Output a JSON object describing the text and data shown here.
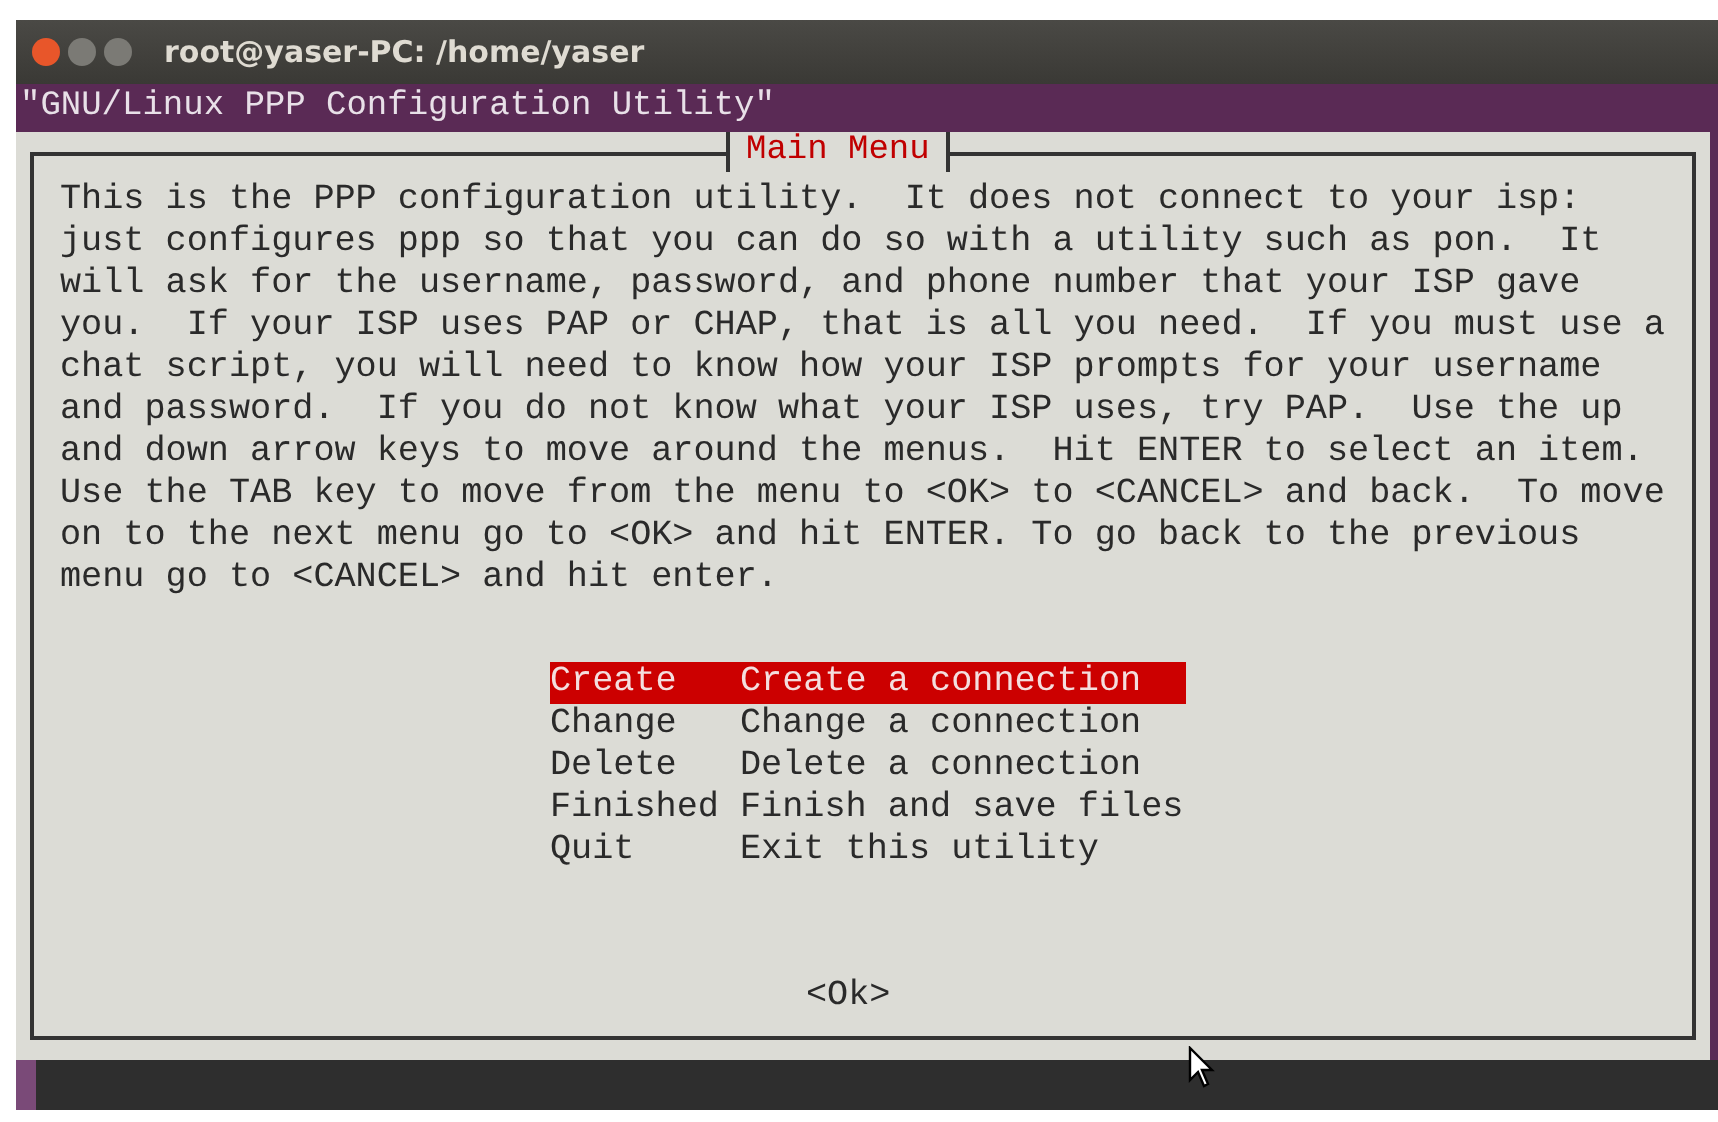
{
  "window": {
    "title": "root@yaser-PC: /home/yaser"
  },
  "backtitle": "\"GNU/Linux PPP Configuration Utility\"",
  "dialog": {
    "title": "Main Menu",
    "message": "This is the PPP configuration utility.  It does not connect to your isp:\njust configures ppp so that you can do so with a utility such as pon.  It\nwill ask for the username, password, and phone number that your ISP gave\nyou.  If your ISP uses PAP or CHAP, that is all you need.  If you must use a\nchat script, you will need to know how your ISP prompts for your username\nand password.  If you do not know what your ISP uses, try PAP.  Use the up\nand down arrow keys to move around the menus.  Hit ENTER to select an item.\nUse the TAB key to move from the menu to <OK> to <CANCEL> and back.  To move\non to the next menu go to <OK> and hit ENTER. To go back to the previous\nmenu go to <CANCEL> and hit enter.",
    "menu": [
      {
        "tag": "Create",
        "description": "Create a connection",
        "selected": true
      },
      {
        "tag": "Change",
        "description": "Change a connection",
        "selected": false
      },
      {
        "tag": "Delete",
        "description": "Delete a connection",
        "selected": false
      },
      {
        "tag": "Finished",
        "description": "Finish and save files",
        "selected": false
      },
      {
        "tag": "Quit",
        "description": "Exit this utility",
        "selected": false
      }
    ],
    "buttons": [
      "<Ok>"
    ]
  }
}
